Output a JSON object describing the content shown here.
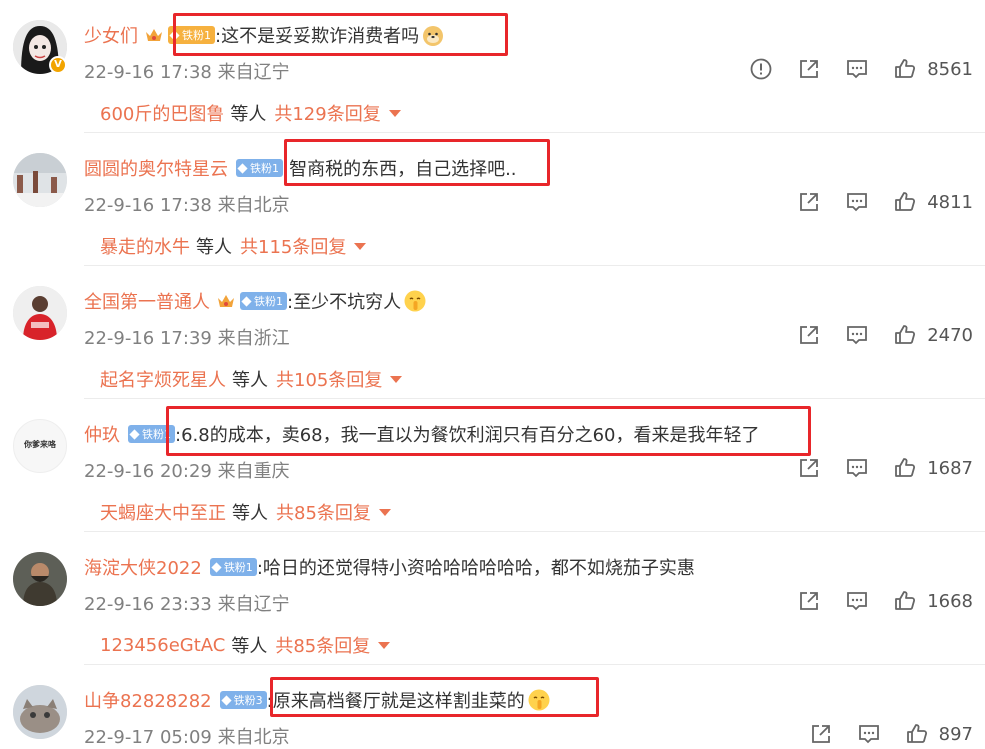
{
  "comments": [
    {
      "username": "少女们",
      "fan_badge": "铁粉1",
      "fan_style": "gold",
      "text": ":这不是妥妥欺诈消费者吗",
      "date": "22-9-16 17:38",
      "location": "来自辽宁",
      "likes": "8561",
      "report": true,
      "reply_user": "600斤的巴图鲁",
      "reply_mid": "等人",
      "reply_total": "共129条回复",
      "emoji": "doge-emoji"
    },
    {
      "username": "圆圆的奥尔特星云",
      "fan_badge": "铁粉1",
      "fan_style": "blue",
      "text": ":智商税的东西，自己选择吧..",
      "date": "22-9-16 17:38",
      "location": "来自北京",
      "likes": "4811",
      "report": false,
      "reply_user": "暴走的水牛",
      "reply_mid": "等人",
      "reply_total": "共115条回复"
    },
    {
      "username": "全国第一普通人",
      "fan_badge": "铁粉1",
      "fan_style": "blue",
      "text": ":至少不坑穷人",
      "date": "22-9-16 17:39",
      "location": "来自浙江",
      "likes": "2470",
      "report": false,
      "reply_user": "起名字烦死星人",
      "reply_mid": "等人",
      "reply_total": "共105条回复",
      "emoji": "shush-emoji"
    },
    {
      "username": "仲玖",
      "fan_badge": "铁粉1",
      "fan_style": "blue",
      "text": ":6.8的成本，卖68，我一直以为餐饮利润只有百分之60，看来是我年轻了",
      "date": "22-9-16 20:29",
      "location": "来自重庆",
      "likes": "1687",
      "report": false,
      "reply_user": "天蝎座大中至正",
      "reply_mid": "等人",
      "reply_total": "共85条回复",
      "avatar_text": "你爹来咯"
    },
    {
      "username": "海淀大侠2022",
      "fan_badge": "铁粉1",
      "fan_style": "blue",
      "text": ":哈日的还觉得特小资哈哈哈哈哈哈，都不如烧茄子实惠",
      "date": "22-9-16 23:33",
      "location": "来自辽宁",
      "likes": "1668",
      "report": false,
      "reply_user": "123456eGtAC",
      "reply_mid": "等人",
      "reply_total": "共85条回复"
    },
    {
      "username": "山争82828282",
      "fan_badge": "铁粉3",
      "fan_style": "blue",
      "text": ":原来高档餐厅就是这样割韭菜的",
      "date": "22-9-17 05:09",
      "location": "来自北京",
      "likes": "897",
      "report": false,
      "emoji": "shush-emoji"
    }
  ],
  "colors": {
    "username": "#eb7350",
    "highlight": "#e8262a",
    "fan_blue": "#7fb1ea",
    "fan_gold": "#f6b13f"
  }
}
